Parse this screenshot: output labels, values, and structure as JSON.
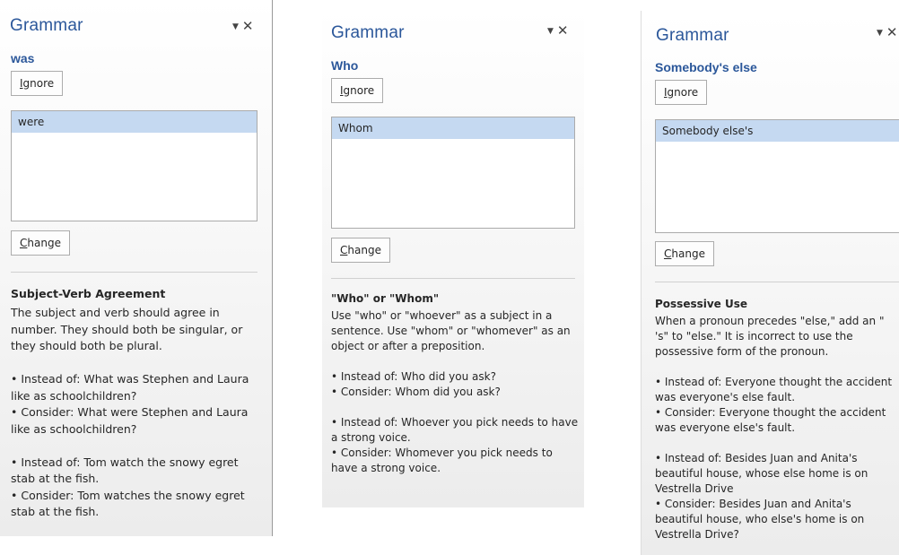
{
  "panes": [
    {
      "title": "Grammar",
      "dropdown_icon": "▼",
      "close_icon": "✕",
      "error_word": "was",
      "ignore_hotkey": "I",
      "ignore_rest": "gnore",
      "suggestions": [
        "were"
      ],
      "change_hotkey": "C",
      "change_rest": "hange",
      "rule_title": "Subject-Verb Agreement",
      "explanation": "The subject and verb should agree in number. They should both be singular, or they should both be plural.",
      "examples": [
        "• Instead of: What was Stephen and Laura like as schoolchildren?",
        "• Consider: What were Stephen and Laura like as schoolchildren?",
        "• Instead of: Tom watch the snowy egret stab at the fish.",
        "• Consider: Tom watches the snowy egret stab at the fish."
      ]
    },
    {
      "title": "Grammar",
      "dropdown_icon": "▼",
      "close_icon": "✕",
      "error_word": "Who",
      "ignore_hotkey": "I",
      "ignore_rest": "gnore",
      "suggestions": [
        "Whom"
      ],
      "change_hotkey": "C",
      "change_rest": "hange",
      "rule_title": "\"Who\" or \"Whom\"",
      "explanation": "Use \"who\" or \"whoever\" as a subject in a sentence.  Use \"whom\" or \"whomever\" as an object or after a preposition.",
      "examples": [
        "• Instead of: Who did you ask?",
        "• Consider: Whom did you ask?",
        "• Instead of: Whoever you pick needs to have a strong voice.",
        "• Consider: Whomever you pick needs to have a strong voice."
      ]
    },
    {
      "title": "Grammar",
      "dropdown_icon": "▼",
      "close_icon": "✕",
      "error_word": "Somebody's else",
      "ignore_hotkey": "I",
      "ignore_rest": "gnore",
      "suggestions": [
        "Somebody else's"
      ],
      "change_hotkey": "C",
      "change_rest": "hange",
      "rule_title": "Possessive Use",
      "explanation": "When a pronoun precedes \"else,\" add an \" 's\" to \"else.\"  It is incorrect to use the possessive form of the pronoun.",
      "examples": [
        "• Instead of: Everyone thought the accident was everyone's else fault.",
        "• Consider: Everyone thought the accident was everyone else's fault.",
        "• Instead of: Besides Juan and Anita's beautiful house, whose else home is on Vestrella Drive",
        "• Consider: Besides Juan and Anita's beautiful house, who else's home is on Vestrella Drive?"
      ]
    }
  ]
}
